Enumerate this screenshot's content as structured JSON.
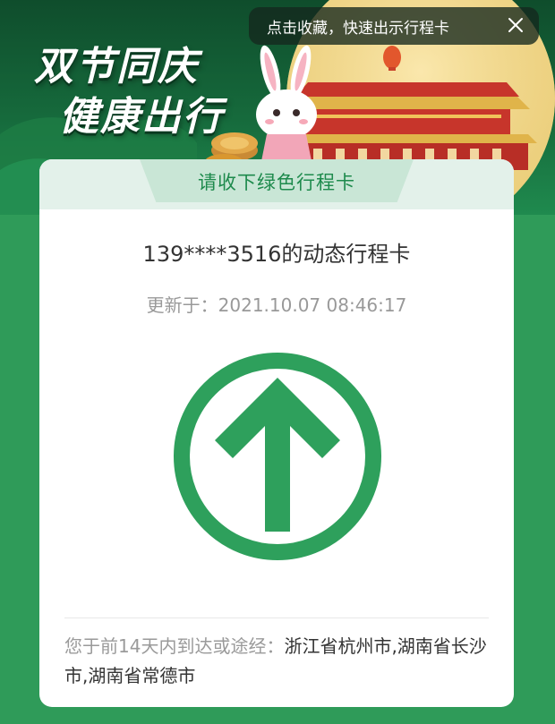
{
  "banner": {
    "slogan_line1": "双节同庆",
    "slogan_line2": "健康出行"
  },
  "favorite_tip": {
    "text": "点击收藏，快速出示行程卡",
    "close_icon": "close-icon"
  },
  "card": {
    "tab_label": "请收下绿色行程卡",
    "title": "139****3516的动态行程卡",
    "updated_label": "更新于：",
    "updated_time": "2021.10.07 08:46:17",
    "status_icon": "green-arrow-up-icon",
    "status_color": "#2ea05c",
    "route_label": "您于前14天内到达或途经：",
    "route_cities": "浙江省杭州市,湖南省长沙市,湖南省常德市"
  },
  "colors": {
    "accent_green": "#2ea05c",
    "banner_dark": "#0f4d2c",
    "background_green": "#2f9b59"
  }
}
